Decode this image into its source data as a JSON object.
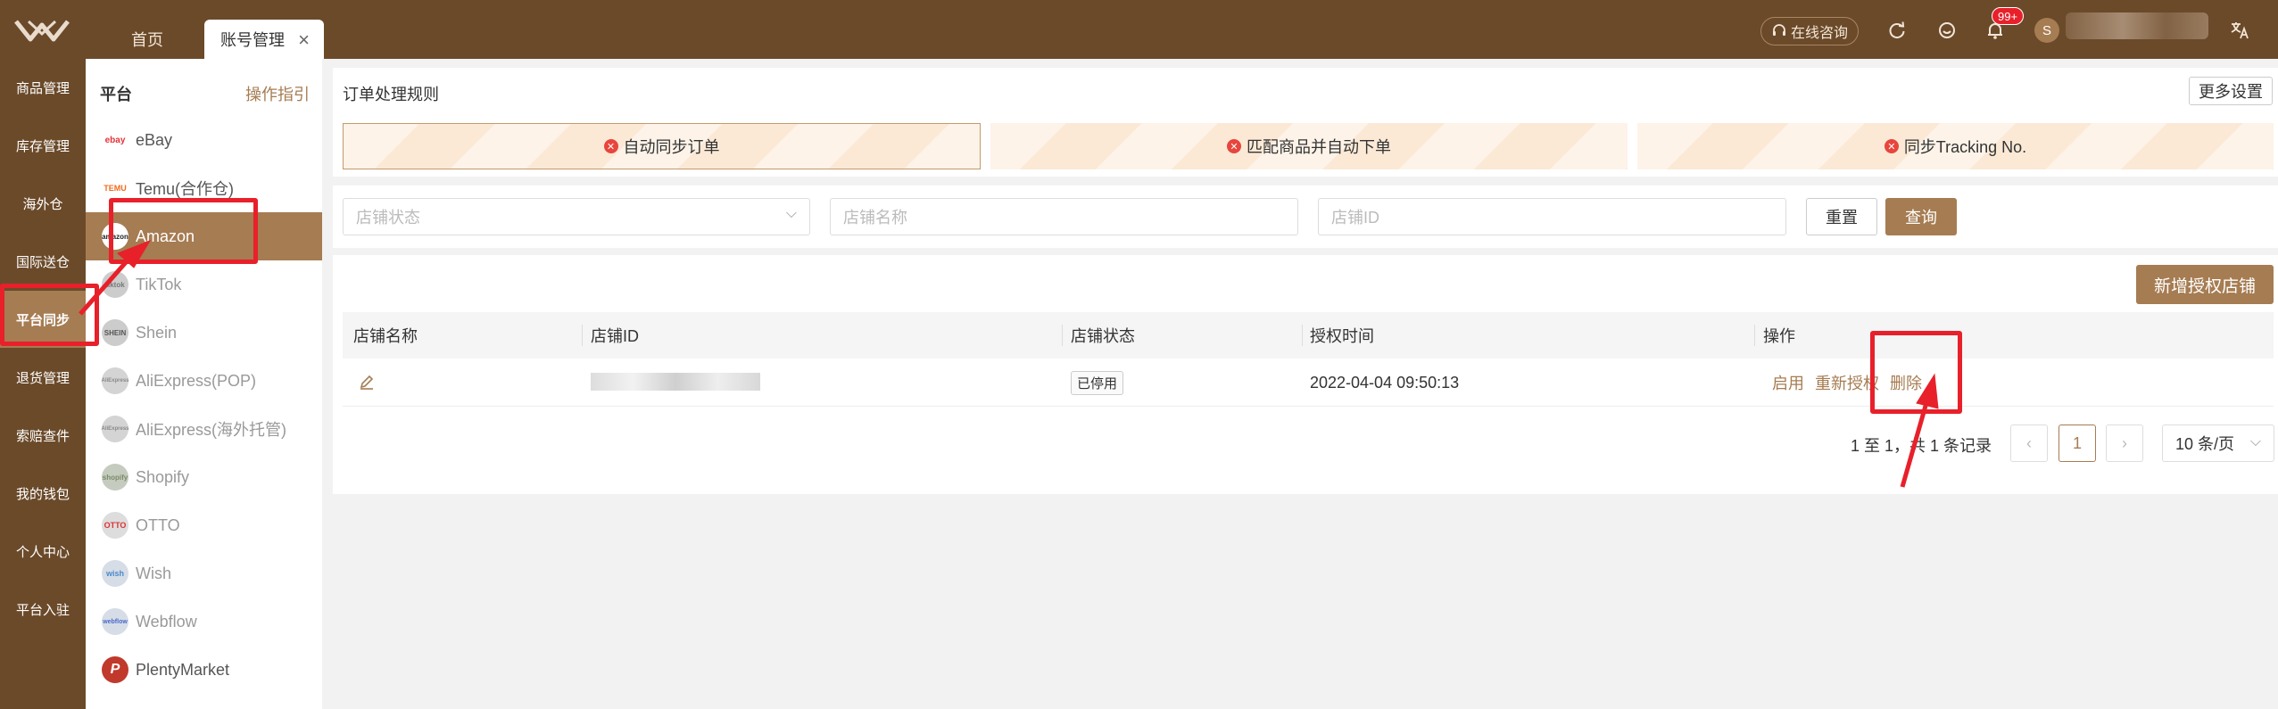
{
  "header": {
    "tabs": [
      {
        "label": "首页"
      },
      {
        "label": "账号管理",
        "close": "×"
      }
    ],
    "consult_label": "在线咨询",
    "notification_count": "99+",
    "avatar_initial": "S",
    "icons": [
      "refresh-icon",
      "feedback-icon",
      "bell-icon",
      "translate-icon"
    ]
  },
  "leftnav": {
    "items": [
      {
        "label": "商品管理"
      },
      {
        "label": "库存管理"
      },
      {
        "label": "海外仓"
      },
      {
        "label": "国际送仓"
      },
      {
        "label": "平台同步",
        "active": true
      },
      {
        "label": "退货管理"
      },
      {
        "label": "索赔查件"
      },
      {
        "label": "我的钱包"
      },
      {
        "label": "个人中心"
      },
      {
        "label": "平台入驻"
      }
    ]
  },
  "platform_panel": {
    "title": "平台",
    "guide_link": "操作指引",
    "platforms": [
      {
        "label": "eBay",
        "icon": "ebay"
      },
      {
        "label": "Temu(合作仓)",
        "icon": "TEMU"
      },
      {
        "label": "Amazon",
        "icon": "amazon",
        "active": true
      },
      {
        "label": "TikTok",
        "icon": "tiktok"
      },
      {
        "label": "Shein",
        "icon": "SHEIN"
      },
      {
        "label": "AliExpress(POP)",
        "icon": "AliExpress"
      },
      {
        "label": "AliExpress(海外托管)",
        "icon": "AliExpress"
      },
      {
        "label": "Shopify",
        "icon": "shopify"
      },
      {
        "label": "OTTO",
        "icon": "OTTO"
      },
      {
        "label": "Wish",
        "icon": "wish"
      },
      {
        "label": "Webflow",
        "icon": "webflow"
      },
      {
        "label": "PlentyMarket",
        "icon": "P"
      }
    ]
  },
  "order_rules": {
    "title": "订单处理规则",
    "more_settings": "更多设置",
    "rules": [
      {
        "label": "自动同步订单"
      },
      {
        "label": "匹配商品并自动下单"
      },
      {
        "label": "同步Tracking No."
      }
    ]
  },
  "filters": {
    "store_status_placeholder": "店铺状态",
    "store_name_placeholder": "店铺名称",
    "store_id_placeholder": "店铺ID",
    "reset": "重置",
    "query": "查询"
  },
  "table": {
    "add_button": "新增授权店铺",
    "columns": [
      "店铺名称",
      "店铺ID",
      "店铺状态",
      "授权时间",
      "操作"
    ],
    "rows": [
      {
        "store_name": "",
        "status": "已停用",
        "auth_time": "2022-04-04 09:50:13",
        "actions": [
          "启用",
          "重新授权",
          "删除"
        ]
      }
    ]
  },
  "pagination": {
    "summary": "1 至 1，共 1 条记录",
    "prev": "‹",
    "current_page": "1",
    "next": "›",
    "page_size": "10 条/页"
  },
  "colors": {
    "brand_dark": "#6b4a2a",
    "brand_accent": "#a67c52",
    "annotation_red": "#e8202a"
  }
}
